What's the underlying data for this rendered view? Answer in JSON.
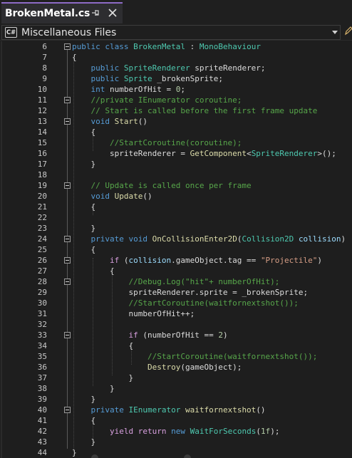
{
  "tab": {
    "title": "BrokenMetal.cs",
    "pin_icon": "pin-icon",
    "close_icon": "close-icon"
  },
  "navbar": {
    "scope_icon_text": "C#",
    "scope_label": "Miscellaneous Files"
  },
  "colors": {
    "keyword": "#569cd6",
    "type": "#4ec9b0",
    "method": "#dcdcaa",
    "string": "#d69d85",
    "comment": "#57a64a",
    "number": "#b5cea8",
    "parameter": "#9cdcfe",
    "control": "#d8a0df",
    "text": "#dcdcdc",
    "tab_accent": "#8e6bc7"
  },
  "editor": {
    "lines": [
      {
        "num": "6",
        "fold": true,
        "tokens": [
          [
            "kw",
            "public"
          ],
          [
            "p",
            " "
          ],
          [
            "kw",
            "class"
          ],
          [
            "p",
            " "
          ],
          [
            "type",
            "BrokenMetal"
          ],
          [
            "p",
            " : "
          ],
          [
            "type",
            "MonoBehaviour"
          ]
        ]
      },
      {
        "num": "7",
        "fold": false,
        "tokens": [
          [
            "p",
            "{"
          ]
        ]
      },
      {
        "num": "8",
        "fold": false,
        "tokens": [
          [
            "p",
            "    "
          ],
          [
            "kw",
            "public"
          ],
          [
            "p",
            " "
          ],
          [
            "type",
            "SpriteRenderer"
          ],
          [
            "p",
            " spriteRenderer;"
          ]
        ]
      },
      {
        "num": "9",
        "fold": false,
        "tokens": [
          [
            "p",
            "    "
          ],
          [
            "kw",
            "public"
          ],
          [
            "p",
            " "
          ],
          [
            "type",
            "Sprite"
          ],
          [
            "p",
            " _brokenSprite;"
          ]
        ]
      },
      {
        "num": "10",
        "fold": false,
        "tokens": [
          [
            "p",
            "    "
          ],
          [
            "kw",
            "int"
          ],
          [
            "p",
            " numberOfHit = "
          ],
          [
            "num",
            "0"
          ],
          [
            "p",
            ";"
          ]
        ]
      },
      {
        "num": "11",
        "fold": true,
        "tokens": [
          [
            "p",
            "    "
          ],
          [
            "cmt",
            "//private IEnumerator coroutine;"
          ]
        ]
      },
      {
        "num": "12",
        "fold": false,
        "tokens": [
          [
            "p",
            "    "
          ],
          [
            "cmt",
            "// Start is called before the first frame update"
          ]
        ]
      },
      {
        "num": "13",
        "fold": true,
        "tokens": [
          [
            "p",
            "    "
          ],
          [
            "kw",
            "void"
          ],
          [
            "p",
            " "
          ],
          [
            "method",
            "Start"
          ],
          [
            "p",
            "()"
          ]
        ]
      },
      {
        "num": "14",
        "fold": false,
        "tokens": [
          [
            "p",
            "    {"
          ]
        ]
      },
      {
        "num": "15",
        "fold": false,
        "tokens": [
          [
            "p",
            "        "
          ],
          [
            "cmt",
            "//StartCoroutine(coroutine);"
          ]
        ]
      },
      {
        "num": "16",
        "fold": false,
        "tokens": [
          [
            "p",
            "        spriteRenderer = "
          ],
          [
            "method",
            "GetComponent"
          ],
          [
            "p",
            "<"
          ],
          [
            "type",
            "SpriteRenderer"
          ],
          [
            "p",
            ">();"
          ]
        ]
      },
      {
        "num": "17",
        "fold": false,
        "tokens": [
          [
            "p",
            "    }"
          ]
        ]
      },
      {
        "num": "18",
        "fold": false,
        "tokens": []
      },
      {
        "num": "19",
        "fold": true,
        "tokens": [
          [
            "p",
            "    "
          ],
          [
            "cmt",
            "// Update is called once per frame"
          ]
        ]
      },
      {
        "num": "20",
        "fold": false,
        "tokens": [
          [
            "p",
            "    "
          ],
          [
            "kw",
            "void"
          ],
          [
            "p",
            " "
          ],
          [
            "method",
            "Update"
          ],
          [
            "p",
            "()"
          ]
        ]
      },
      {
        "num": "21",
        "fold": false,
        "tokens": [
          [
            "p",
            "    {"
          ]
        ]
      },
      {
        "num": "22",
        "fold": false,
        "tokens": []
      },
      {
        "num": "23",
        "fold": false,
        "tokens": [
          [
            "p",
            "    }"
          ]
        ]
      },
      {
        "num": "24",
        "fold": true,
        "tokens": [
          [
            "p",
            "    "
          ],
          [
            "kw",
            "private"
          ],
          [
            "p",
            " "
          ],
          [
            "kw",
            "void"
          ],
          [
            "p",
            " "
          ],
          [
            "method",
            "OnCollisionEnter2D"
          ],
          [
            "p",
            "("
          ],
          [
            "type",
            "Collision2D"
          ],
          [
            "p",
            " "
          ],
          [
            "param",
            "collision"
          ],
          [
            "p",
            ")"
          ]
        ]
      },
      {
        "num": "25",
        "fold": false,
        "tokens": [
          [
            "p",
            "    {"
          ]
        ]
      },
      {
        "num": "26",
        "fold": true,
        "tokens": [
          [
            "p",
            "        "
          ],
          [
            "ctrl",
            "if"
          ],
          [
            "p",
            " ("
          ],
          [
            "param",
            "collision"
          ],
          [
            "p",
            ".gameObject.tag == "
          ],
          [
            "str",
            "\"Projectile\""
          ],
          [
            "p",
            ")"
          ]
        ]
      },
      {
        "num": "27",
        "fold": false,
        "tokens": [
          [
            "p",
            "        {"
          ]
        ]
      },
      {
        "num": "28",
        "fold": true,
        "tokens": [
          [
            "p",
            "            "
          ],
          [
            "cmt",
            "//Debug.Log(\"hit\"+ numberOfHit);"
          ]
        ]
      },
      {
        "num": "29",
        "fold": false,
        "tokens": [
          [
            "p",
            "            spriteRenderer.sprite = _brokenSprite;"
          ]
        ]
      },
      {
        "num": "30",
        "fold": false,
        "tokens": [
          [
            "p",
            "            "
          ],
          [
            "cmt",
            "//StartCoroutine(waitfornextshot());"
          ]
        ]
      },
      {
        "num": "31",
        "fold": false,
        "tokens": [
          [
            "p",
            "            numberOfHit++;"
          ]
        ]
      },
      {
        "num": "32",
        "fold": false,
        "tokens": []
      },
      {
        "num": "33",
        "fold": true,
        "tokens": [
          [
            "p",
            "            "
          ],
          [
            "ctrl",
            "if"
          ],
          [
            "p",
            " (numberOfHit == "
          ],
          [
            "num",
            "2"
          ],
          [
            "p",
            ")"
          ]
        ]
      },
      {
        "num": "34",
        "fold": false,
        "tokens": [
          [
            "p",
            "            {"
          ]
        ]
      },
      {
        "num": "35",
        "fold": false,
        "tokens": [
          [
            "p",
            "                "
          ],
          [
            "cmt",
            "//StartCoroutine(waitfornextshot());"
          ]
        ]
      },
      {
        "num": "36",
        "fold": false,
        "tokens": [
          [
            "p",
            "                "
          ],
          [
            "method",
            "Destroy"
          ],
          [
            "p",
            "(gameObject);"
          ]
        ]
      },
      {
        "num": "37",
        "fold": false,
        "tokens": [
          [
            "p",
            "            }"
          ]
        ]
      },
      {
        "num": "38",
        "fold": false,
        "tokens": [
          [
            "p",
            "        }"
          ]
        ]
      },
      {
        "num": "39",
        "fold": false,
        "tokens": [
          [
            "p",
            "    }"
          ]
        ]
      },
      {
        "num": "40",
        "fold": true,
        "tokens": [
          [
            "p",
            "    "
          ],
          [
            "kw",
            "private"
          ],
          [
            "p",
            " "
          ],
          [
            "type",
            "IEnumerator"
          ],
          [
            "p",
            " "
          ],
          [
            "method",
            "waitfornextshot"
          ],
          [
            "p",
            "()"
          ]
        ]
      },
      {
        "num": "41",
        "fold": false,
        "tokens": [
          [
            "p",
            "    {"
          ]
        ]
      },
      {
        "num": "42",
        "fold": false,
        "tokens": [
          [
            "p",
            "        "
          ],
          [
            "ctrl",
            "yield"
          ],
          [
            "p",
            " "
          ],
          [
            "ctrl",
            "return"
          ],
          [
            "p",
            " "
          ],
          [
            "kw",
            "new"
          ],
          [
            "p",
            " "
          ],
          [
            "type",
            "WaitForSeconds"
          ],
          [
            "p",
            "("
          ],
          [
            "num",
            "1f"
          ],
          [
            "p",
            ");"
          ]
        ]
      },
      {
        "num": "43",
        "fold": false,
        "tokens": [
          [
            "p",
            "    }"
          ]
        ]
      },
      {
        "num": "44",
        "fold": false,
        "tokens": [
          [
            "p",
            "}"
          ]
        ]
      }
    ]
  }
}
